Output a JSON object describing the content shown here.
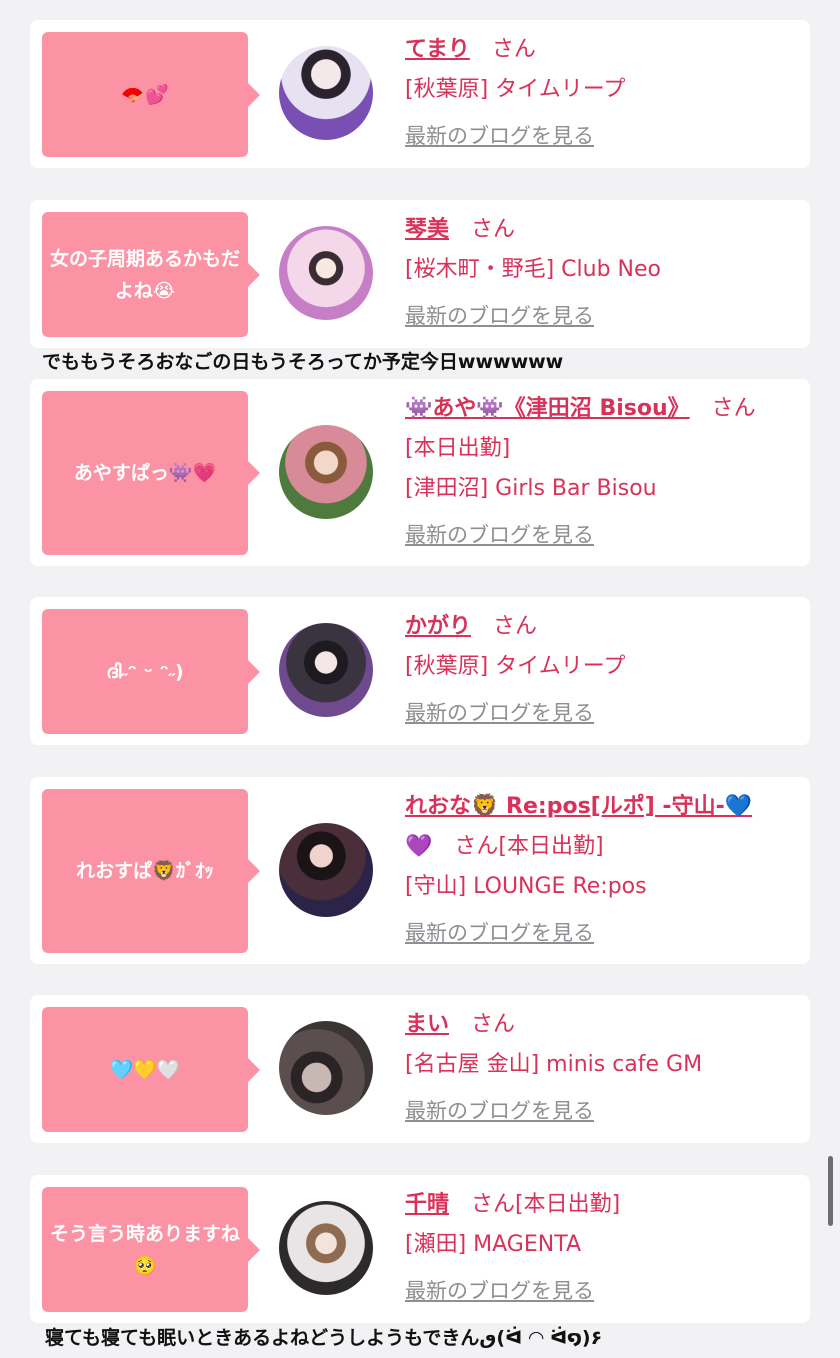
{
  "cards": [
    {
      "bubble": "🪭💕",
      "name": "てまり",
      "suffix": "さん",
      "lines": [
        "[秋葉原] タイムリープ"
      ],
      "blog_link": "最新のブログを見る",
      "avatar_colors": [
        "#e7e2f2",
        "#7a4fb3"
      ]
    },
    {
      "bubble": "女の子周期あるかもだよね😭",
      "name": "琴美",
      "suffix": "さん",
      "lines": [
        "[桜木町・野毛] Club Neo"
      ],
      "blog_link": "最新のブログを見る",
      "avatar_colors": [
        "#f4d7e8",
        "#c67fc7"
      ]
    },
    {
      "bubble": "あやすぱっ👾💗",
      "name": "👾あや👾《津田沼 Bisou》",
      "suffix": "さん",
      "lines": [
        "[本日出勤]",
        "[津田沼] Girls Bar Bisou"
      ],
      "blog_link": "最新のブログを見る",
      "avatar_colors": [
        "#d98a98",
        "#4f7a3e"
      ]
    },
    {
      "bubble": "ദി˶ᵔ ᵕ ᵔ˶)",
      "name": "かがり",
      "suffix": "さん",
      "lines": [
        "[秋葉原] タイムリープ"
      ],
      "blog_link": "最新のブログを見る",
      "avatar_colors": [
        "#3a3440",
        "#6f4a8f"
      ]
    },
    {
      "bubble": "れおすぱ🦁ｶﾞｵｯ",
      "name": "れおな🦁 Re:pos[ルポ] -守山-💙",
      "name_line2": "💜",
      "suffix": "さん",
      "suffix_extra": "[本日出勤]",
      "lines": [
        "[守山] LOUNGE Re:pos"
      ],
      "blog_link": "最新のブログを見る",
      "avatar_colors": [
        "#4a2f3a",
        "#2b2448"
      ]
    },
    {
      "bubble": "🩵💛🤍",
      "name": "まい",
      "suffix": "さん",
      "lines": [
        "[名古屋 金山] minis cafe GM"
      ],
      "blog_link": "最新のブログを見る",
      "avatar_colors": [
        "#5a4e4e",
        "#c9b7b4"
      ]
    },
    {
      "bubble": "そう言う時ありますね🥺",
      "name": "千晴",
      "suffix": "さん",
      "suffix_extra": "[本日出勤]",
      "lines": [
        "[瀬田] MAGENTA"
      ],
      "blog_link": "最新のブログを見る",
      "avatar_colors": [
        "#e9e4e6",
        "#2d2a2c"
      ]
    }
  ],
  "free_texts": {
    "after_card2": "でももうそろおなごの日もうそろってか予定今日wwwwww",
    "after_card7": "寝ても寝ても眠いときあるよねどうしようもできんٯ(ᐛ ◠ ᐛ໑)۶"
  },
  "colors": {
    "accent_pink": "#fc93a5",
    "name_red": "#d8325a",
    "link_gray": "#8e8e93",
    "background": "#f2f2f4"
  }
}
